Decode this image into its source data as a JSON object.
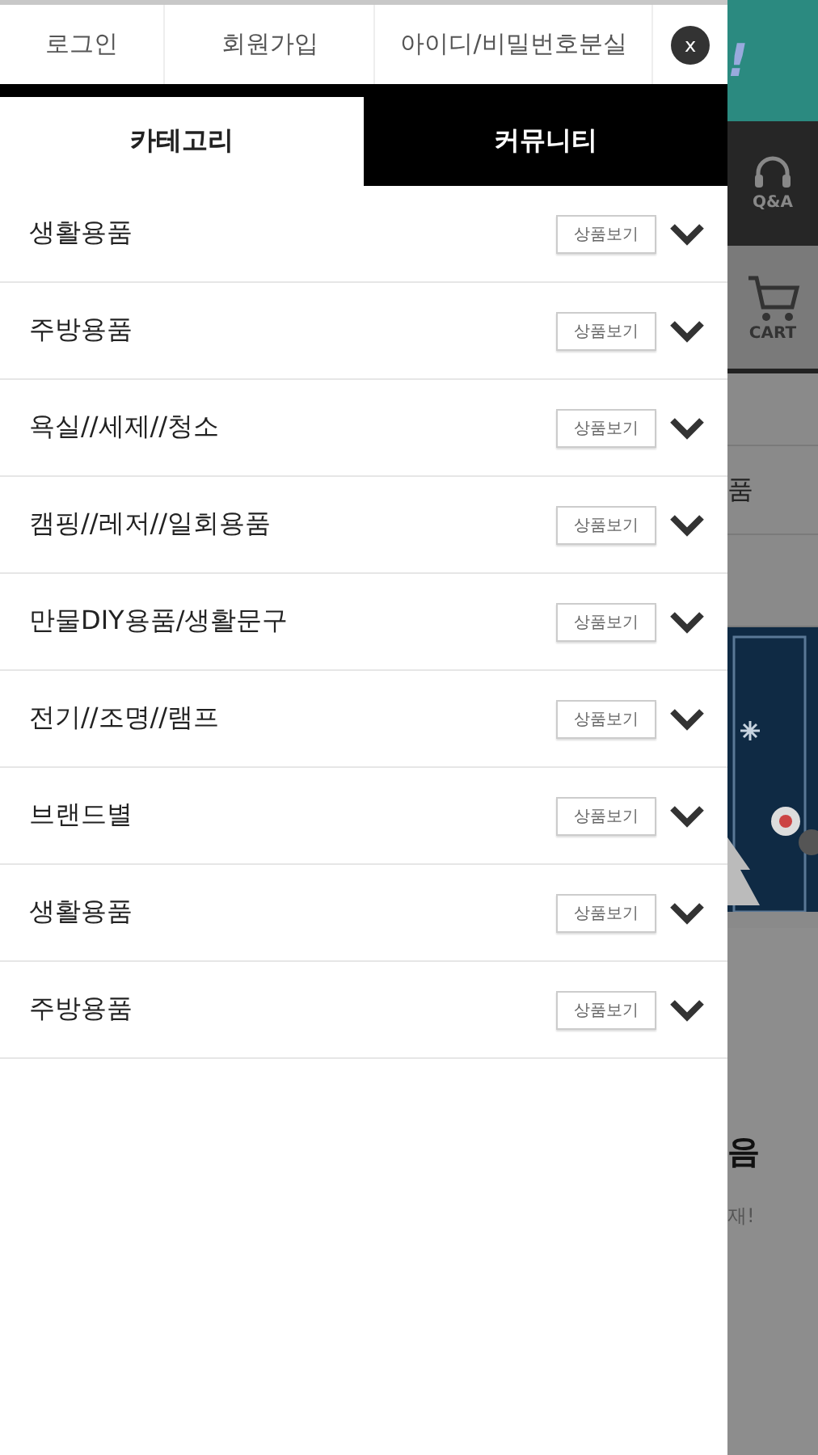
{
  "top_links": [
    {
      "label": "로그인"
    },
    {
      "label": "회원가입"
    },
    {
      "label": "아이디/비밀번호분실"
    }
  ],
  "close_button": {
    "label": "x"
  },
  "tabs": [
    {
      "label": "카테고리",
      "selected": true
    },
    {
      "label": "커뮤니티",
      "selected": false
    }
  ],
  "categories": [
    {
      "name": "생활용품",
      "button": "상품보기",
      "expanded": false
    },
    {
      "name": "주방용품",
      "button": "상품보기",
      "expanded": false
    },
    {
      "name": "욕실//세제//청소",
      "button": "상품보기",
      "expanded": false
    },
    {
      "name": "캠핑//레저//일회용품",
      "button": "상품보기",
      "expanded": false
    },
    {
      "name": "만물DIY용품/생활문구",
      "button": "상품보기",
      "expanded": false
    },
    {
      "name": "전기//조명//램프",
      "button": "상품보기",
      "expanded": false
    },
    {
      "name": "브랜드별",
      "button": "상품보기",
      "expanded": false
    },
    {
      "name": "생활용품",
      "button": "상품보기",
      "expanded": false
    },
    {
      "name": "주방용품",
      "button": "상품보기",
      "expanded": false
    }
  ],
  "background_page": {
    "banner_mark": "!",
    "qa_label": "Q&A",
    "cart_label": "CART",
    "menu_fragment": "품",
    "promo_title_fragment": "음",
    "promo_text_fragment": "재!"
  }
}
